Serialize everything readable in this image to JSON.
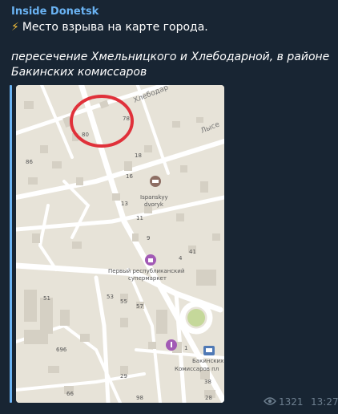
{
  "post": {
    "channel_name": "Inside Donetsk",
    "emoji": "⚡",
    "line1": "Место взрыва на карте города.",
    "line2a": "пересечение Хмельницкого и Хлебодарной, в районе",
    "line2b": "Бакинских комиссаров",
    "views": "1321",
    "time": "13:27"
  },
  "map": {
    "street_top": "Хлебодар",
    "street_right": "Лысе",
    "house_numbers": [
      "78",
      "80",
      "86",
      "18",
      "16",
      "13",
      "11",
      "9",
      "4",
      "41",
      "53",
      "55",
      "57",
      "51",
      "696",
      "1",
      "29",
      "38",
      "66",
      "98",
      "28"
    ],
    "poi_1": "Ispanskyy",
    "poi_1b": "dvoryk",
    "poi_2": "Первый республиканский",
    "poi_2b": "супермаркет",
    "poi_3": "Бакинских",
    "poi_3b": "Комиссаров пл",
    "highlight_color": "#e0313a"
  }
}
